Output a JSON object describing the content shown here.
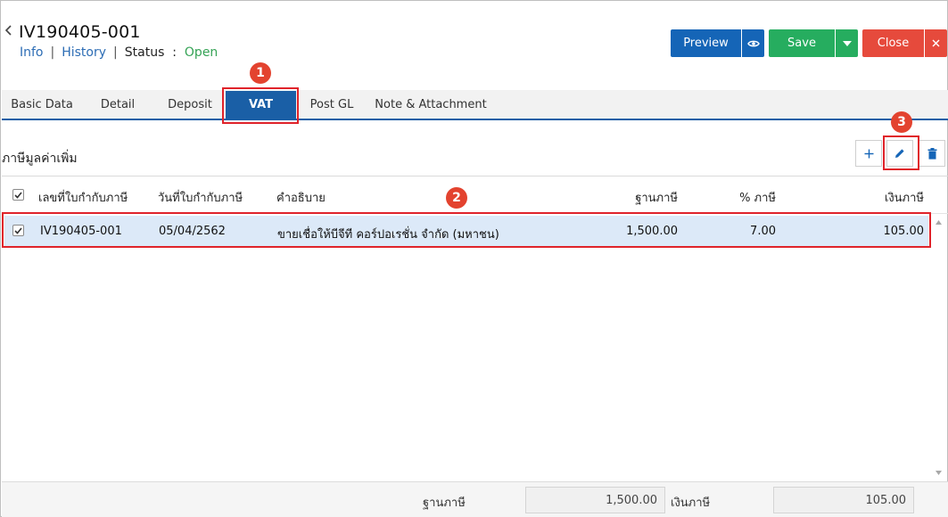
{
  "header": {
    "doc_no": "IV190405-001",
    "info_link": "Info",
    "history_link": "History",
    "status_label": "Status",
    "status_colon": ":",
    "status_value": "Open"
  },
  "toolbar": {
    "preview_label": "Preview",
    "save_label": "Save",
    "close_label": "Close"
  },
  "tabs": [
    {
      "label": "Basic Data",
      "active": false
    },
    {
      "label": "Detail",
      "active": false
    },
    {
      "label": "Deposit",
      "active": false
    },
    {
      "label": "VAT",
      "active": true
    },
    {
      "label": "Post GL",
      "active": false
    },
    {
      "label": "Note & Attachment",
      "active": false
    }
  ],
  "callouts": [
    "1",
    "2",
    "3"
  ],
  "section": {
    "title": "ภาษีมูลค่าเพิ่ม"
  },
  "table": {
    "columns": [
      "เลขที่ใบกำกับภาษี",
      "วันที่ใบกำกับภาษี",
      "คำอธิบาย",
      "ฐานภาษี",
      "% ภาษี",
      "เงินภาษี"
    ],
    "rows": [
      {
        "checked": true,
        "selected": true,
        "invoice_no": "IV190405-001",
        "invoice_date": "05/04/2562",
        "description": "ขายเชื่อให้บีจีที คอร์ปอเรชั่น จำกัด (มหาชน)",
        "tax_base": "1,500.00",
        "tax_rate": "7.00",
        "tax_amount": "105.00"
      }
    ]
  },
  "footer": {
    "tax_base_label": "ฐานภาษี",
    "tax_base_value": "1,500.00",
    "tax_amount_label": "เงินภาษี",
    "tax_amount_value": "105.00"
  },
  "colors": {
    "primary_blue": "#1565b7",
    "tab_active": "#1a5fa6",
    "save_green": "#26ad5f",
    "close_red": "#e64a3c",
    "status_green": "#36a356",
    "callout_red": "#e3432f",
    "row_selected": "#dce9f8"
  },
  "icons": {
    "back": "chevron-left-icon",
    "preview_eye": "eye-icon",
    "save_dropdown": "caret-down-icon",
    "close_x": "close-icon",
    "add": "plus-icon",
    "edit": "pencil-icon",
    "delete": "trash-icon",
    "checkbox": "check-icon"
  }
}
